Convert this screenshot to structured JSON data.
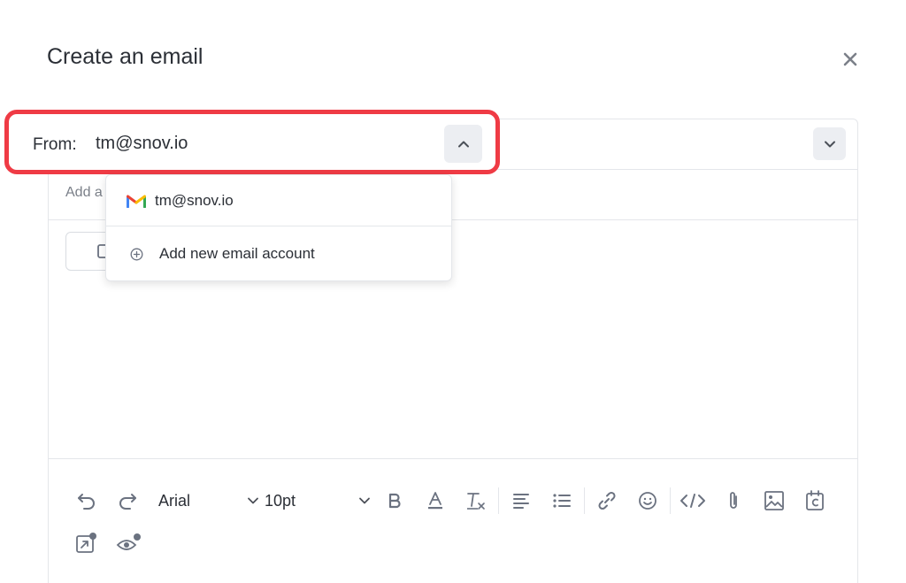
{
  "modal": {
    "title": "Create an email"
  },
  "from": {
    "label": "From:",
    "value": "tm@snov.io"
  },
  "to": {
    "placeholder": "Add a"
  },
  "dropdown": {
    "account": "tm@snov.io",
    "add_label": "Add new email account"
  },
  "toolbar": {
    "font": "Arial",
    "size": "10pt"
  },
  "icons": {
    "close": "close-icon",
    "from_toggle": "chevron-up-icon",
    "row_toggle": "chevron-down-icon",
    "account": "gmail-icon",
    "add": "plus-circle-icon",
    "undo": "undo-icon",
    "redo": "redo-icon",
    "bold": "bold-icon",
    "text_color": "text-color-icon",
    "clear_format": "clear-format-icon",
    "align": "align-left-icon",
    "list": "bullet-list-icon",
    "link": "link-icon",
    "emoji": "emoji-icon",
    "code": "code-icon",
    "attach": "paperclip-icon",
    "image": "image-icon",
    "calendar": "calendar-icon",
    "external": "external-link-icon",
    "preview": "eye-icon"
  },
  "colors": {
    "highlight": "#ef3b45",
    "text": "#2b2f36",
    "muted": "#6b7280",
    "button_bg": "#eceef2"
  }
}
